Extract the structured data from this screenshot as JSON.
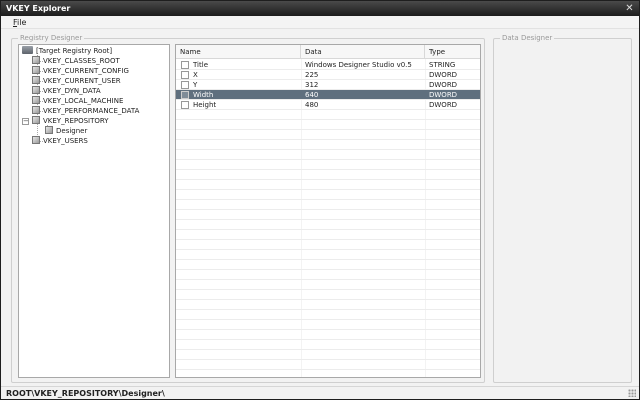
{
  "window": {
    "title": "VKEY Explorer",
    "close_glyph": "✕"
  },
  "menu": {
    "file_label": "File",
    "file_accel": "F",
    "file_rest": "ile"
  },
  "groups": {
    "registry_designer": "Registry Designer",
    "data_designer": "Data Designer"
  },
  "tree": {
    "root_label": "[Target Registry Root]",
    "items": [
      {
        "label": "VKEY_CLASSES_ROOT"
      },
      {
        "label": "VKEY_CURRENT_CONFIG"
      },
      {
        "label": "VKEY_CURRENT_USER"
      },
      {
        "label": "VKEY_DYN_DATA"
      },
      {
        "label": "VKEY_LOCAL_MACHINE"
      },
      {
        "label": "VKEY_PERFORMANCE_DATA"
      },
      {
        "label": "VKEY_REPOSITORY",
        "expanded": true,
        "expander_glyph": "−"
      },
      {
        "label": "Designer",
        "child": true
      },
      {
        "label": "VKEY_USERS"
      }
    ],
    "root_expander_glyph": "−"
  },
  "list": {
    "columns": [
      "Name",
      "Data",
      "Type"
    ],
    "rows": [
      {
        "name": "Title",
        "data": "Windows Designer Studio v0.5",
        "type": "STRING",
        "selected": false
      },
      {
        "name": "X",
        "data": "225",
        "type": "DWORD",
        "selected": false
      },
      {
        "name": "Y",
        "data": "312",
        "type": "DWORD",
        "selected": false
      },
      {
        "name": "Width",
        "data": "640",
        "type": "DWORD",
        "selected": true
      },
      {
        "name": "Height",
        "data": "480",
        "type": "DWORD",
        "selected": false
      }
    ]
  },
  "status": {
    "path": "ROOT\\VKEY_REPOSITORY\\Designer\\"
  },
  "colors": {
    "titlebar": "#2a2a2a",
    "selection": "#5f6f7e"
  },
  "icons": [
    "close-icon",
    "registry-root-icon",
    "registry-key-icon",
    "checkbox-icon",
    "resize-grip-icon"
  ]
}
